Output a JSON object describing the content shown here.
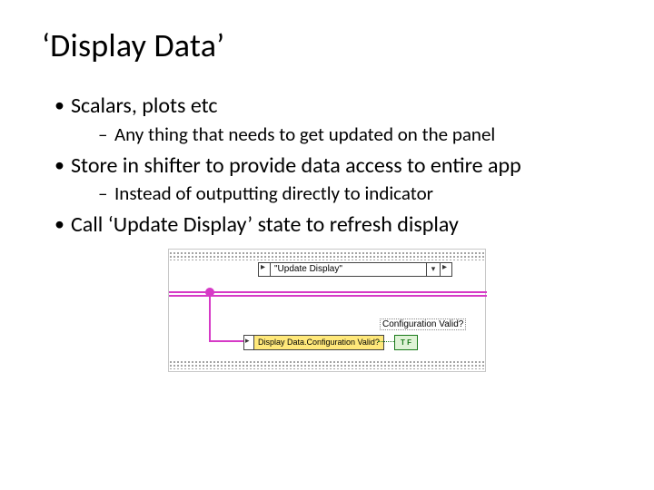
{
  "title": "‘Display Data’",
  "bullets": [
    {
      "text": "Scalars, plots etc",
      "sub": [
        "Any thing that needs to get updated on the panel"
      ]
    },
    {
      "text": "Store in shifter to provide data access to entire app",
      "sub": [
        "Instead of outputting directly to indicator"
      ]
    },
    {
      "text": "Call ‘Update Display’ state to refresh display",
      "sub": []
    }
  ],
  "diagram": {
    "state_name": "\"Update Display\"",
    "unbundle_label": "Display Data.Configuration Valid?",
    "bool_label": "Configuration Valid?",
    "bool_node": "T F"
  }
}
